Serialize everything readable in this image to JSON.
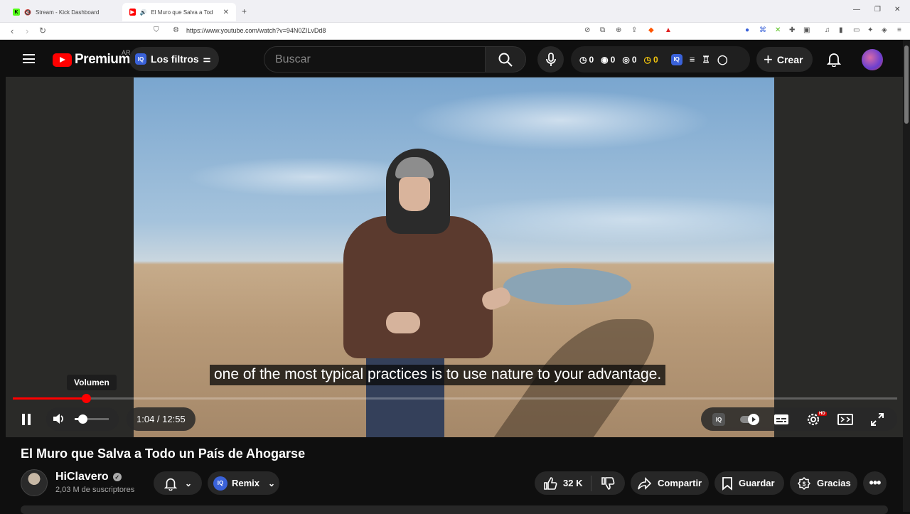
{
  "browser": {
    "tabs": [
      {
        "title": "Stream - Kick Dashboard",
        "active": false,
        "favicon_color": "#53fc18"
      },
      {
        "title": "El Muro que Salva a Todo un",
        "active": true,
        "favicon_color": "#ff0000"
      }
    ],
    "url": "https://www.youtube.com/watch?v=94N0ZILvDd8"
  },
  "header": {
    "logo_word": "Premium",
    "country_code": "AR",
    "filters_label": "Los filtros",
    "filters_badge": "IQ",
    "search_placeholder": "Buscar",
    "stats": [
      "0",
      "0",
      "0",
      "0"
    ],
    "create_label": "Crear"
  },
  "player": {
    "subtitle": "one of the most typical practices is to use nature to your advantage.",
    "tooltip": "Volumen",
    "time_display": "1:04 / 12:55",
    "progress_fraction": 0.0828,
    "volume_fraction": 0.22,
    "hd_badge": "HD",
    "iq_badge": "IQ"
  },
  "video_info": {
    "title": "El Muro que Salva a Todo un País de Ahogarse",
    "channel_name": "HiClavero",
    "subscribers": "2,03 M de suscriptores",
    "remix_label": "Remix",
    "remix_badge": "IQ",
    "likes": "32 K",
    "share_label": "Compartir",
    "save_label": "Guardar",
    "thanks_label": "Gracias"
  },
  "colors": {
    "accent": "#ff0000",
    "background": "#0f0f0f",
    "iq_blue": "#3a62d9",
    "stat_yellow": "#f1c40f"
  }
}
